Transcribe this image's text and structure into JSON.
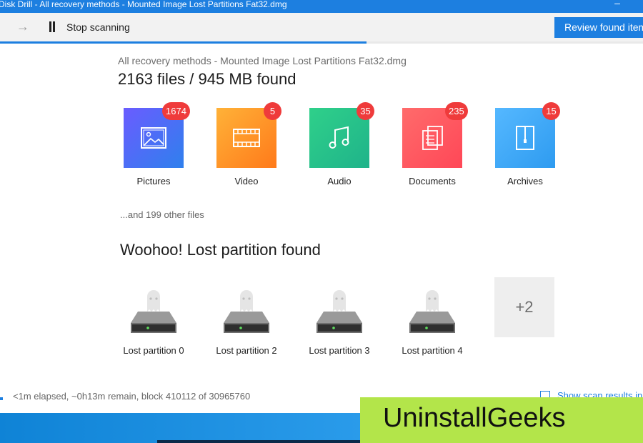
{
  "window": {
    "title": "Disk Drill - All recovery methods - Mounted Image Lost Partitions Fat32.dmg"
  },
  "toolbar": {
    "stop_label": "Stop scanning",
    "review_label": "Review found items",
    "scan_progress_fraction": 0.57
  },
  "main": {
    "subtitle": "All recovery methods - Mounted Image Lost Partitions Fat32.dmg",
    "headline": "2163 files / 945 MB found",
    "categories": [
      {
        "label": "Pictures",
        "count": "1674",
        "icon": "picture-icon",
        "color_from": "#6a5cff",
        "color_to": "#2f80ed"
      },
      {
        "label": "Video",
        "count": "5",
        "icon": "film-icon",
        "color_from": "#ffb238",
        "color_to": "#ff7a1a"
      },
      {
        "label": "Audio",
        "count": "35",
        "icon": "music-note-icon",
        "color_from": "#2fd08a",
        "color_to": "#1fb38a"
      },
      {
        "label": "Documents",
        "count": "235",
        "icon": "documents-icon",
        "color_from": "#ff6b6b",
        "color_to": "#ff4757"
      },
      {
        "label": "Archives",
        "count": "15",
        "icon": "archive-icon",
        "color_from": "#55b8ff",
        "color_to": "#2e9bf0"
      }
    ],
    "other_files": "...and 199 other files",
    "lost_partition_title": "Woohoo! Lost partition found",
    "partitions": [
      {
        "label": "Lost partition 0"
      },
      {
        "label": "Lost partition 2"
      },
      {
        "label": "Lost partition 3"
      },
      {
        "label": "Lost partition 4"
      }
    ],
    "more_partitions": "+2"
  },
  "status": {
    "text": "<1m elapsed, ~0h13m remain, block 410112 of 30965760",
    "show_results": "Show scan results in Finder"
  },
  "watermark": {
    "text": "UninstallGeeks"
  },
  "colors": {
    "accent": "#1d7fe0",
    "badge": "#ef3b3b",
    "watermark_bg": "#b3e54a"
  }
}
